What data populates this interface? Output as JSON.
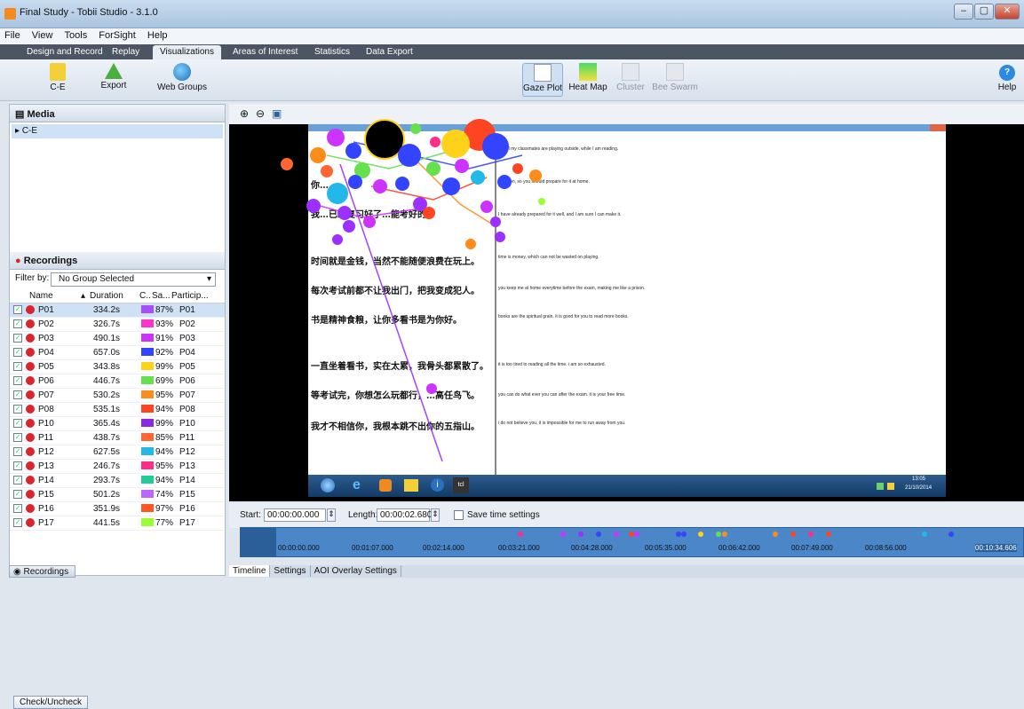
{
  "window": {
    "title": "Final Study - Tobii Studio - 3.1.0",
    "controls": [
      "–",
      "▢",
      "✕"
    ]
  },
  "menu": [
    "File",
    "View",
    "Tools",
    "ForSight",
    "Help"
  ],
  "tabs": [
    "Design and Record",
    "Replay",
    "Visualizations",
    "Areas of Interest",
    "Statistics",
    "Data Export"
  ],
  "toolbar": {
    "ce": "C-E",
    "export": "Export",
    "web_groups": "Web Groups",
    "gaze_plot": "Gaze Plot",
    "heat_map": "Heat Map",
    "cluster": "Cluster",
    "bee_swarm": "Bee Swarm",
    "help": "Help"
  },
  "media": {
    "header": "Media",
    "item": "C-E"
  },
  "recordings": {
    "header": "Recordings",
    "filter_label": "Filter by:",
    "filter_value": "No Group Selected",
    "columns": [
      "Name",
      "Duration",
      "C..",
      "Sa...",
      "Particip..."
    ],
    "rows": [
      {
        "name": "P01",
        "duration": "334.2s",
        "color": "#a64dff",
        "sample": "87%",
        "participant": "P01"
      },
      {
        "name": "P02",
        "duration": "326.7s",
        "color": "#ff33cc",
        "sample": "93%",
        "participant": "P02"
      },
      {
        "name": "P03",
        "duration": "490.1s",
        "color": "#cc33ff",
        "sample": "91%",
        "participant": "P03"
      },
      {
        "name": "P04",
        "duration": "657.0s",
        "color": "#3344ff",
        "sample": "92%",
        "participant": "P04"
      },
      {
        "name": "P05",
        "duration": "343.8s",
        "color": "#ffd21a",
        "sample": "99%",
        "participant": "P05"
      },
      {
        "name": "P06",
        "duration": "446.7s",
        "color": "#66e04d",
        "sample": "69%",
        "participant": "P06"
      },
      {
        "name": "P07",
        "duration": "530.2s",
        "color": "#ff8c1a",
        "sample": "95%",
        "participant": "P07"
      },
      {
        "name": "P08",
        "duration": "535.1s",
        "color": "#ff4422",
        "sample": "94%",
        "participant": "P08"
      },
      {
        "name": "P10",
        "duration": "365.4s",
        "color": "#8a2be2",
        "sample": "99%",
        "participant": "P10"
      },
      {
        "name": "P11",
        "duration": "438.7s",
        "color": "#ff6633",
        "sample": "85%",
        "participant": "P11"
      },
      {
        "name": "P12",
        "duration": "627.5s",
        "color": "#22b8e8",
        "sample": "94%",
        "participant": "P12"
      },
      {
        "name": "P13",
        "duration": "246.7s",
        "color": "#ff2d8a",
        "sample": "95%",
        "participant": "P13"
      },
      {
        "name": "P14",
        "duration": "293.7s",
        "color": "#22cc99",
        "sample": "94%",
        "participant": "P14"
      },
      {
        "name": "P15",
        "duration": "501.2s",
        "color": "#bb66ff",
        "sample": "74%",
        "participant": "P15"
      },
      {
        "name": "P16",
        "duration": "351.9s",
        "color": "#ff5522",
        "sample": "97%",
        "participant": "P16"
      },
      {
        "name": "P17",
        "duration": "441.5s",
        "color": "#99ff33",
        "sample": "77%",
        "participant": "P17"
      }
    ],
    "check_button": "Check/Uncheck"
  },
  "bottom_left_tab": "Recordings",
  "document": {
    "sentences_cn": [
      "你…",
      "我…已经复习好了…能考好的。",
      "时间就是金钱，当然不能随便浪费在玩上。",
      "每次考试前都不让我出门，把我变成犯人。",
      "书是精神食粮，让你多看书是为你好。",
      "一直坐着看书，实在太累，我骨头都累散了。",
      "等考试完，你想怎么玩都行，…高任鸟飞。",
      "我才不相信你，我根本跳不出你的五指山。"
    ],
    "sentences_en": [
      "ay, all my classmates are playing outside, while I am reading.",
      "exa…on, so you should prepare for it at home.",
      "I have already prepared for it well, and I am sure I can make it.",
      "time is money, which can not be wasted on playing.",
      "you keep me at home everytime before the exam, making me like a prison.",
      "books are the spiritual grain. it is good for you to read more books.",
      "it is too tired to reading all the time. i am so exhausted.",
      "you can do what ever you can after the exam. it is your free time.",
      "i do not believe you, it is impossible for me to run away from you."
    ],
    "clock_time": "13:05",
    "clock_date": "21/10/2014"
  },
  "controls": {
    "start_label": "Start:",
    "start_value": "00:00:00.000",
    "length_label": "Length:",
    "length_value": "00:00:02.680",
    "save_label": "Save time settings"
  },
  "timeline_labels": [
    "00:00:00.000",
    "00:01:07.000",
    "00:02:14.000",
    "00:03:21.000",
    "00:04:28.000",
    "00:05:35.000",
    "00:06:42.000",
    "00:07:49.000",
    "00:08:56.000",
    "00:10:34.606"
  ],
  "bottom_tabs": [
    "Timeline",
    "Settings",
    "AOI Overlay Settings"
  ]
}
